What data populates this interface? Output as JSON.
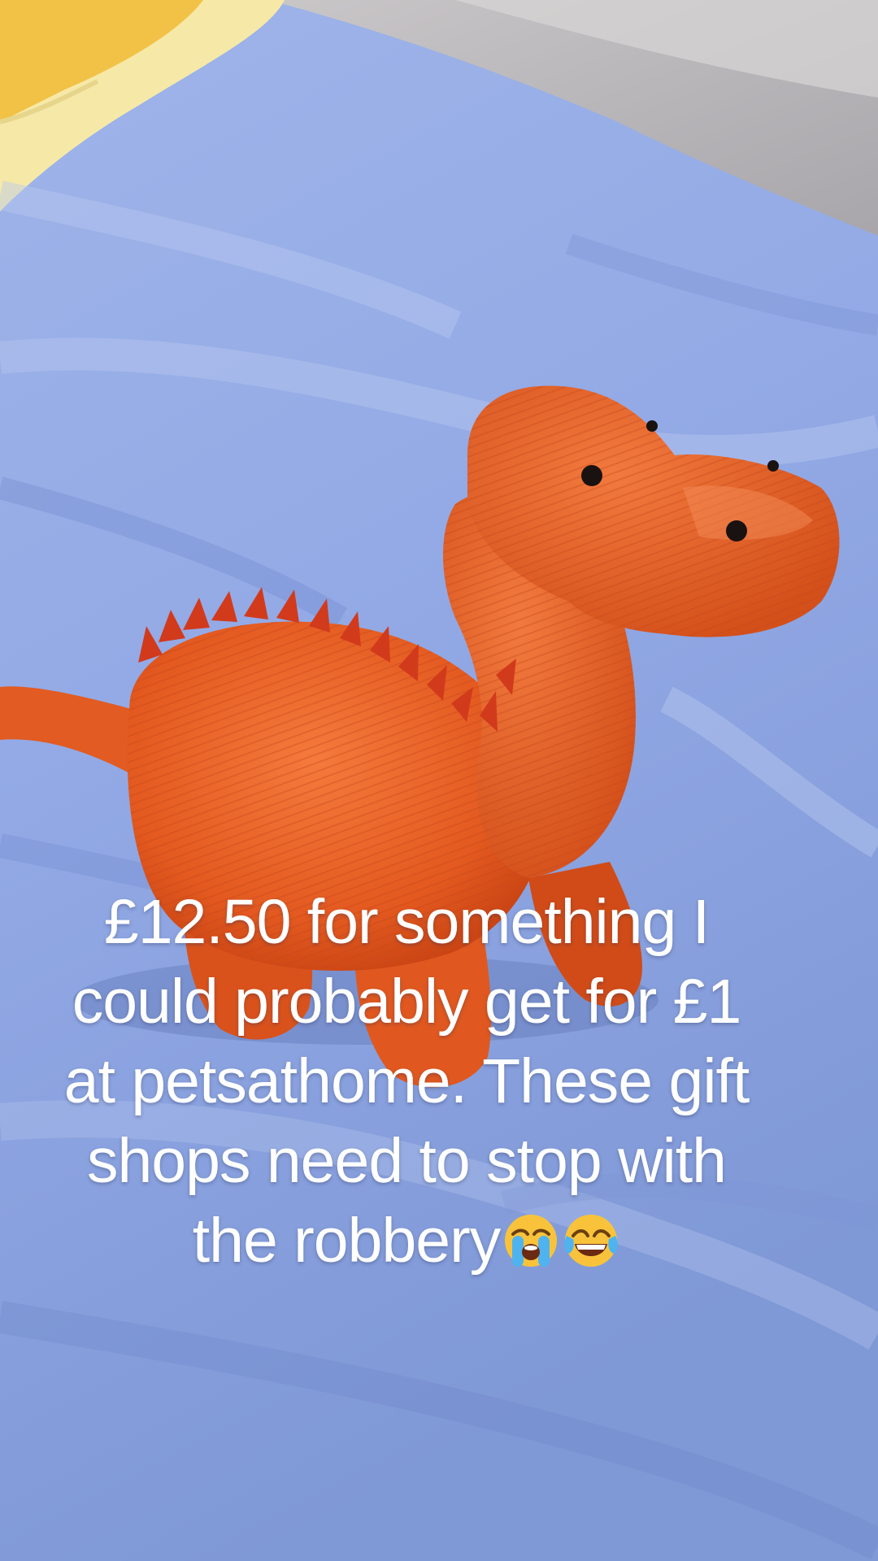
{
  "caption": {
    "lines": [
      "£12.50 for something I",
      "could probably get for £1",
      "at petsathome. These gift",
      "shops need to stop with",
      "the robbery"
    ],
    "emojis": [
      "loudly-crying-face-icon",
      "face-with-tears-of-joy-icon"
    ]
  },
  "colors": {
    "sheet": "#8fa8e2",
    "dinosaur": "#e8622a",
    "spikes": "#d63a1e",
    "pillow": "#f3c44a",
    "caption_text": "#ffffff"
  }
}
